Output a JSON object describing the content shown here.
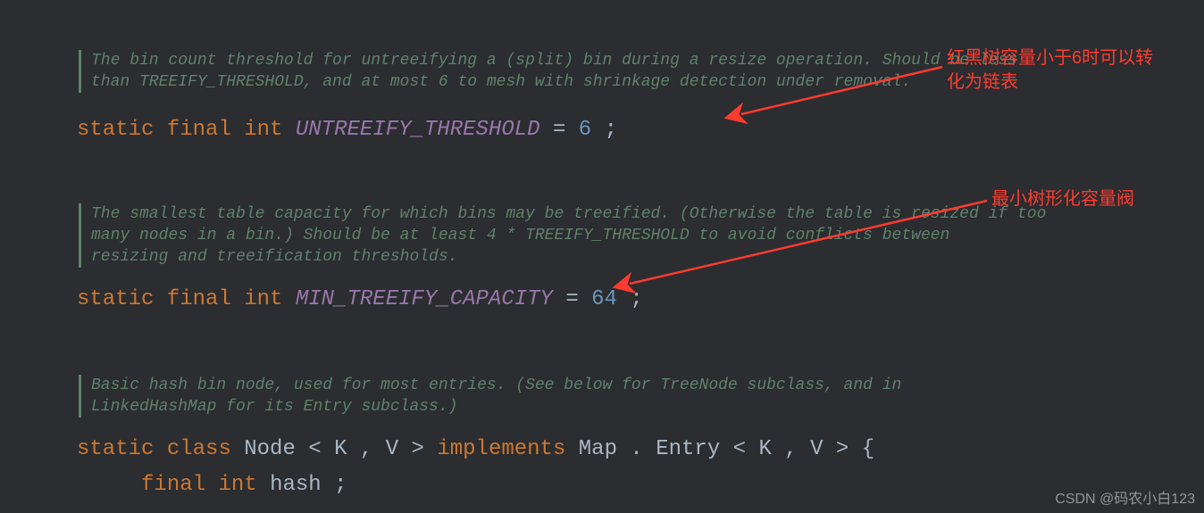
{
  "comments": {
    "c1_l1": "The bin count threshold for untreeifying a (split) bin during a resize operation. Should be less",
    "c1_l2": "than TREEIFY_THRESHOLD, and at most 6 to mesh with shrinkage detection under removal.",
    "c2_l1": "The smallest table capacity for which bins may be treeified. (Otherwise the table is resized if too",
    "c2_l2": "many nodes in a bin.) Should be at least 4 * TREEIFY_THRESHOLD to avoid conflicts between",
    "c2_l3": "resizing and treeification thresholds.",
    "c3_l1": "Basic hash bin node, used for most entries. (See below for TreeNode subclass, and in",
    "c3_l2": "LinkedHashMap for its Entry subclass.)"
  },
  "kw": {
    "static": "static",
    "final": "final",
    "int": "int",
    "class": "class",
    "implements": "implements"
  },
  "code": {
    "untreeify_name": "UNTREEIFY_THRESHOLD",
    "untreeify_val": "6",
    "mincap_name": "MIN_TREEIFY_CAPACITY",
    "mincap_val": "64",
    "node": "Node",
    "genK": "K",
    "genV": "V",
    "map": "Map",
    "entry": "Entry",
    "hash": "hash",
    "eq": " = ",
    "semi": ";",
    "lt": "<",
    "gt": ">",
    "comma": ",",
    "dot": ".",
    "brace": " {"
  },
  "annotations": {
    "a1_l1": "红黑树容量小于6时可以转",
    "a1_l2": "化为链表",
    "a2": "最小树形化容量阀"
  },
  "watermark": "CSDN @码农小白123"
}
